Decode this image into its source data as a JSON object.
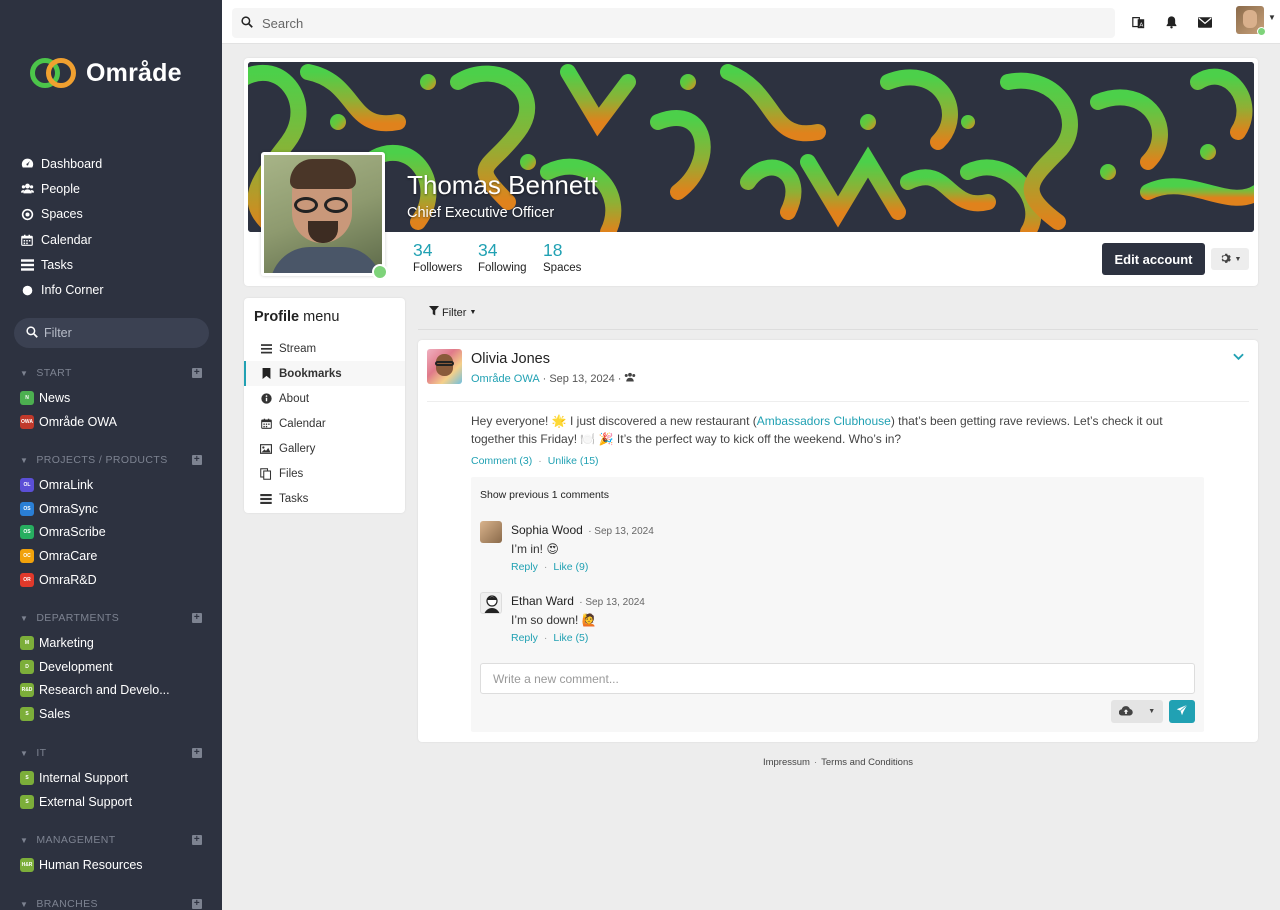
{
  "app": {
    "name": "Område"
  },
  "sidebar": {
    "nav": [
      {
        "label": "Dashboard",
        "icon": "dashboard-icon"
      },
      {
        "label": "People",
        "icon": "people-icon"
      },
      {
        "label": "Spaces",
        "icon": "spaces-icon"
      },
      {
        "label": "Calendar",
        "icon": "calendar-icon"
      },
      {
        "label": "Tasks",
        "icon": "tasks-icon"
      },
      {
        "label": "Info Corner",
        "icon": "info-corner-icon"
      }
    ],
    "filter_placeholder": "Filter",
    "sections": [
      {
        "title": "START",
        "items": [
          {
            "label": "News",
            "badge": "N",
            "color": "#4caf50"
          },
          {
            "label": "Område OWA",
            "badge": "OWA",
            "color": "#c0392b"
          }
        ]
      },
      {
        "title": "PROJECTS / PRODUCTS",
        "items": [
          {
            "label": "OmraLink",
            "badge": "OL",
            "color": "#5b4fd6"
          },
          {
            "label": "OmraSync",
            "badge": "OS",
            "color": "#2a7fd6"
          },
          {
            "label": "OmraScribe",
            "badge": "OS",
            "color": "#27ae60"
          },
          {
            "label": "OmraCare",
            "badge": "OC",
            "color": "#f1a20b"
          },
          {
            "label": "OmraR&D",
            "badge": "OR",
            "color": "#e0392b"
          }
        ]
      },
      {
        "title": "DEPARTMENTS",
        "items": [
          {
            "label": "Marketing",
            "badge": "M",
            "color": "#7cae3a"
          },
          {
            "label": "Development",
            "badge": "D",
            "color": "#7cae3a"
          },
          {
            "label": "Research and Develo...",
            "badge": "R&D",
            "color": "#7cae3a"
          },
          {
            "label": "Sales",
            "badge": "S",
            "color": "#7cae3a"
          }
        ]
      },
      {
        "title": "IT",
        "items": [
          {
            "label": "Internal Support",
            "badge": "S",
            "color": "#7cae3a"
          },
          {
            "label": "External Support",
            "badge": "S",
            "color": "#7cae3a"
          }
        ]
      },
      {
        "title": "MANAGEMENT",
        "items": [
          {
            "label": "Human Resources",
            "badge": "H&R",
            "color": "#7cae3a"
          }
        ]
      },
      {
        "title": "BRANCHES",
        "items": []
      }
    ]
  },
  "topbar": {
    "search_placeholder": "Search"
  },
  "profile": {
    "name": "Thomas Bennett",
    "title": "Chief Executive Officer",
    "stats": [
      {
        "num": "34",
        "label": "Followers"
      },
      {
        "num": "34",
        "label": "Following"
      },
      {
        "num": "18",
        "label": "Spaces"
      }
    ],
    "edit_label": "Edit account"
  },
  "profile_menu": {
    "title_bold": "Profile",
    "title_rest": " menu",
    "items": [
      {
        "label": "Stream",
        "icon": "stream-icon",
        "active": false
      },
      {
        "label": "Bookmarks",
        "icon": "bookmark-icon",
        "active": true
      },
      {
        "label": "About",
        "icon": "info-icon",
        "active": false
      },
      {
        "label": "Calendar",
        "icon": "calendar-icon",
        "active": false
      },
      {
        "label": "Gallery",
        "icon": "gallery-icon",
        "active": false
      },
      {
        "label": "Files",
        "icon": "files-icon",
        "active": false
      },
      {
        "label": "Tasks",
        "icon": "tasks-icon",
        "active": false
      }
    ]
  },
  "stream": {
    "filter_label": "Filter",
    "post": {
      "author": "Olivia Jones",
      "space": "Område OWA",
      "date": "Sep 13, 2024",
      "text_before": "Hey everyone! 🌟 I just discovered a new restaurant (",
      "link": "Ambassadors Clubhouse",
      "text_after": ") that’s been getting rave reviews. Let’s check it out together this Friday! 🍽️ 🎉 It’s the perfect way to kick off the weekend. Who’s in?",
      "comment_action": "Comment (3)",
      "like_action": "Unlike (15)",
      "show_previous": "Show previous 1 comments",
      "comments": [
        {
          "author": "Sophia Wood",
          "date": "Sep 13, 2024",
          "text": "I’m in! 😍",
          "reply": "Reply",
          "like": "Like (9)"
        },
        {
          "author": "Ethan Ward",
          "date": "Sep 13, 2024",
          "text": "I’m so down! 🙋",
          "reply": "Reply",
          "like": "Like (5)"
        }
      ],
      "comment_placeholder": "Write a new comment..."
    }
  },
  "footer": {
    "impressum": "Impressum",
    "terms": "Terms and Conditions"
  }
}
